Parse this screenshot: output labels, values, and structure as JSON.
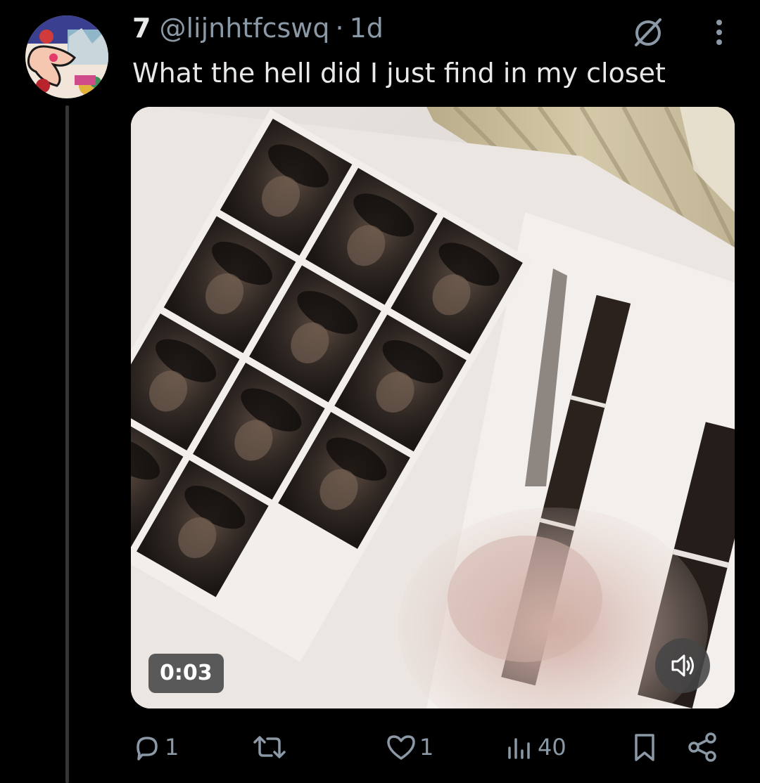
{
  "tweet": {
    "display_name": "7",
    "handle": "@lijnhtfcswq",
    "separator": "·",
    "time": "1d",
    "text": "What the hell did I just find in my closet",
    "avatar_icon": "cartoon-hand-avatar",
    "grok_icon": "grok-icon",
    "more_icon": "more-vertical-icon"
  },
  "media": {
    "type": "video",
    "duration": "0:03",
    "volume_icon": "speaker-icon"
  },
  "actions": {
    "reply_count": "1",
    "retweet_count": "",
    "like_count": "1",
    "views_count": "40"
  },
  "colors": {
    "background": "#000000",
    "text_primary": "#e7e9ea",
    "text_secondary": "#8b98a5",
    "thread_line": "#333639"
  }
}
